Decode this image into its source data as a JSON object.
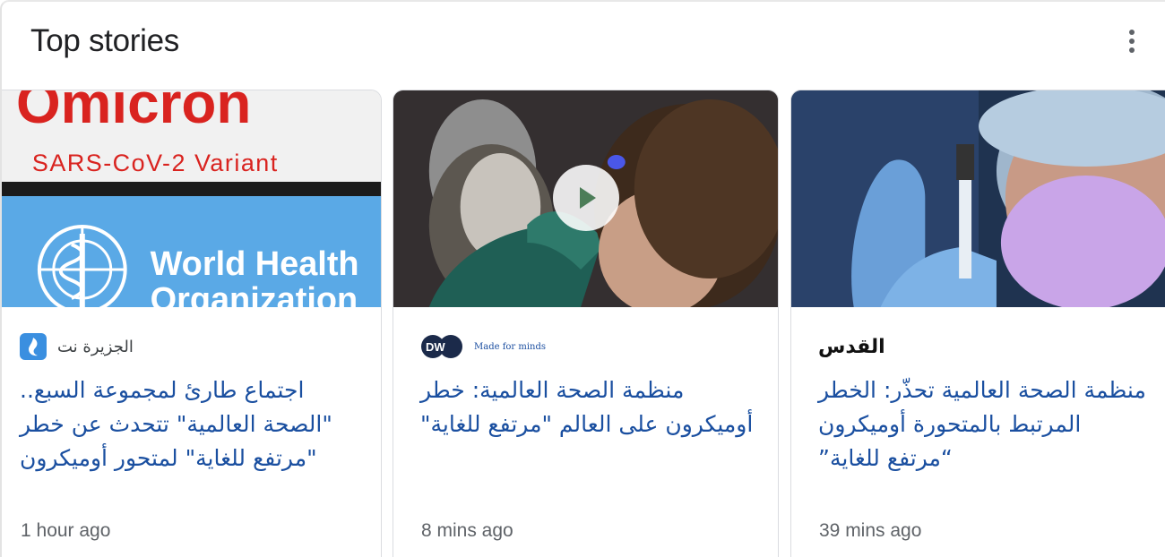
{
  "header": {
    "title": "Top stories",
    "menu_icon": "more-vert-icon"
  },
  "cards": [
    {
      "image_text_top": "Omicron",
      "image_text_sub": "SARS-CoV-2 Variant",
      "image_text_org1": "World Health",
      "image_text_org2": "Organization",
      "source_name": "الجزيرة نت",
      "headline_lines": [
        "اجتماع طارئ لمجموعة السبع..",
        "\"الصحة العالمية\" تتحدث عن خطر",
        "\"مرتفع للغاية\" لمتحور أوميكرون"
      ],
      "time": "1 hour ago"
    },
    {
      "has_video": true,
      "source_logo_text": "DW",
      "source_tagline": "Made for minds",
      "headline_lines": [
        "منظمة الصحة العالمية: خطر",
        "أوميكرون على العالم \"مرتفع للغاية\""
      ],
      "time": "8 mins ago"
    },
    {
      "source_logo_text": "القدس",
      "headline_lines": [
        "منظمة الصحة العالمية تحذّر: الخطر",
        "المرتبط بالمتحورة أوميكرون",
        "“مرتفع للغاية”"
      ],
      "time": "39 mins ago"
    }
  ],
  "colors": {
    "headline": "#1a4fa0",
    "who_blue": "#5aa9e6",
    "omicron_red": "#d9231f"
  }
}
